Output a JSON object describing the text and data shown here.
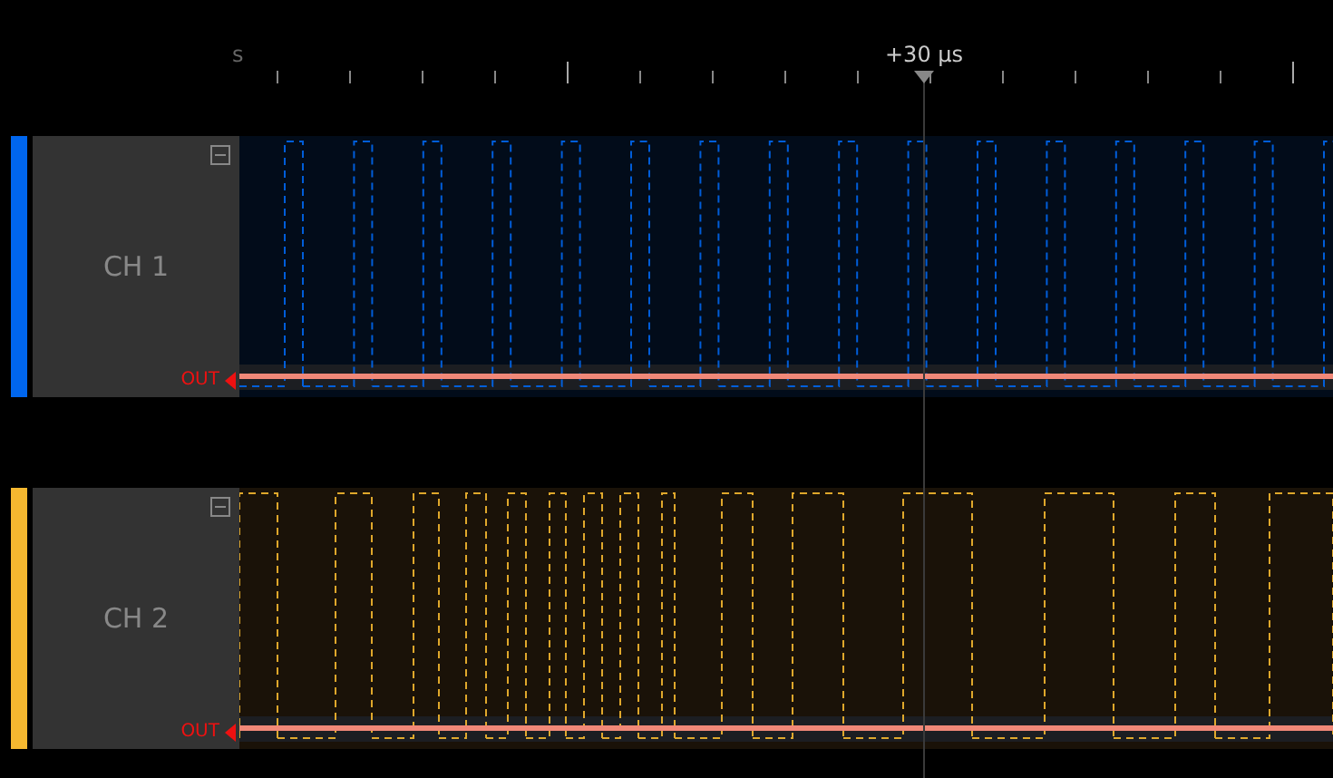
{
  "ruler": {
    "labels": [
      {
        "kind": "edge",
        "text": "s"
      },
      {
        "kind": "cursor",
        "text": "+30 µs"
      }
    ]
  },
  "channels": [
    {
      "name": "CH 1",
      "color": "#0066ee",
      "output": "OUT",
      "kind": "clock"
    },
    {
      "name": "CH 2",
      "color": "#f5b830",
      "output": "OUT",
      "kind": "data"
    }
  ]
}
